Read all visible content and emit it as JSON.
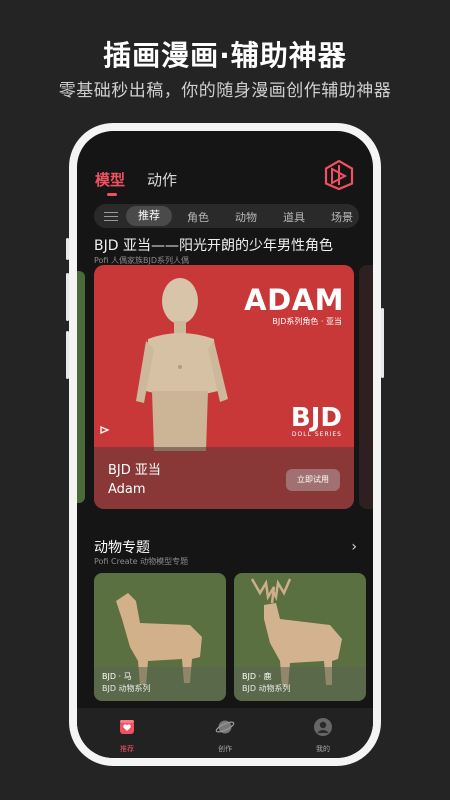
{
  "promo": {
    "headline": "插画漫画·辅助神器",
    "subline": "零基础秒出稿，你的随身漫画创作辅助神器"
  },
  "app": {
    "tabs": [
      {
        "label": "模型",
        "active": true
      },
      {
        "label": "动作",
        "active": false
      }
    ],
    "brand_color": "#f05060",
    "categories": [
      {
        "label": "推荐",
        "active": true
      },
      {
        "label": "角色"
      },
      {
        "label": "动物"
      },
      {
        "label": "道具"
      },
      {
        "label": "场景"
      }
    ],
    "featured": {
      "section_title": "BJD 亚当——阳光开朗的少年男性角色",
      "section_subtitle": "Pofi 人偶家族BJD系列人偶",
      "big_title": "ADAM",
      "big_subtitle": "BJD系列角色 · 亚当",
      "badge": "BJD",
      "badge_sub": "DOLL SERIES",
      "name_cn": "BJD 亚当",
      "name_en": "Adam",
      "cta_label": "立即试用",
      "card_color": "#c83838"
    },
    "animals": {
      "section_title": "动物专题",
      "section_subtitle": "Pofi Create 动物模型专题",
      "items": [
        {
          "name": "BJD · 马",
          "sub": "BJD 动物系列"
        },
        {
          "name": "BJD · 鹿",
          "sub": "BJD 动物系列"
        }
      ]
    },
    "nav": [
      {
        "label": "推荐",
        "icon": "recommend-icon",
        "active": true
      },
      {
        "label": "创作",
        "icon": "planet-icon",
        "active": false
      },
      {
        "label": "我的",
        "icon": "profile-icon",
        "active": false
      }
    ]
  }
}
